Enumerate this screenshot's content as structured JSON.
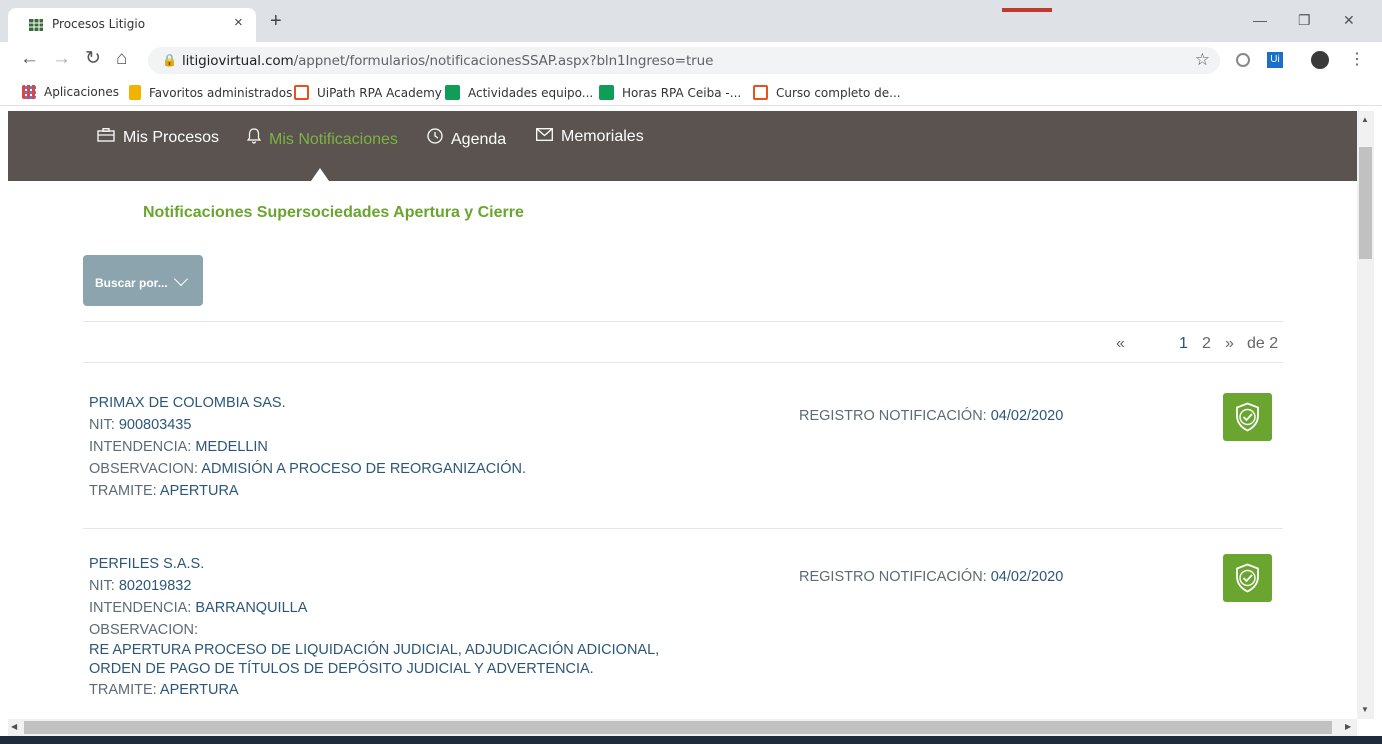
{
  "browser": {
    "tab_title": "Procesos Litigio",
    "tab_close": "×",
    "new_tab": "+",
    "url_host": "litigiovirtual.com",
    "url_path": "/appnet/formularios/notificacionesSSAP.aspx?bln1Ingreso=true",
    "bookmarks": [
      {
        "label": "Aplicaciones",
        "icon": "apps-grid-icon"
      },
      {
        "label": "Favoritos administrados",
        "icon": "folder-icon"
      },
      {
        "label": "UiPath RPA Academy",
        "icon": "uipath-icon"
      },
      {
        "label": "Actividades equipo...",
        "icon": "sheets-icon"
      },
      {
        "label": "Horas RPA Ceiba -...",
        "icon": "sheets-icon"
      },
      {
        "label": "Curso completo de...",
        "icon": "uipath-icon"
      }
    ]
  },
  "nav": {
    "items": [
      {
        "label": "Mis Procesos",
        "icon": "briefcase-icon"
      },
      {
        "label": "Mis Notificaciones",
        "icon": "bell-icon",
        "active": true
      },
      {
        "label": "Agenda",
        "icon": "clock-icon"
      },
      {
        "label": "Memoriales",
        "icon": "envelope-icon"
      }
    ]
  },
  "page": {
    "title": "Notificaciones Supersociedades Apertura y Cierre",
    "search_label": "Buscar por...",
    "pager": {
      "prev": "«",
      "pages": [
        "1",
        "2"
      ],
      "current": "1",
      "next": "»",
      "total": "de 2"
    }
  },
  "labels": {
    "nit": "NIT:",
    "intendencia": "INTENDENCIA:",
    "observacion": "OBSERVACION:",
    "tramite": "TRAMITE:",
    "registro": "REGISTRO NOTIFICACIÓN:"
  },
  "records": [
    {
      "company": "PRIMAX DE COLOMBIA SAS.",
      "nit": "900803435",
      "intendencia": "MEDELLIN",
      "observacion": "ADMISIÓN A PROCESO DE REORGANIZACIÓN.",
      "tramite": "APERTURA",
      "registro": "04/02/2020"
    },
    {
      "company": "PERFILES S.A.S.",
      "nit": "802019832",
      "intendencia": "BARRANQUILLA",
      "observacion_line1": "RE APERTURA PROCESO DE LIQUIDACIÓN JUDICIAL, ADJUDICACIÓN ADICIONAL,",
      "observacion_line2": "ORDEN DE PAGO DE TÍTULOS DE DEPÓSITO JUDICIAL Y ADVERTENCIA.",
      "tramite": "APERTURA",
      "registro": "04/02/2020"
    }
  ],
  "colors": {
    "accent": "#6aa52f",
    "navbar": "#5a5350",
    "text_blue": "#2c5777",
    "search_button": "#8ca4ad"
  }
}
